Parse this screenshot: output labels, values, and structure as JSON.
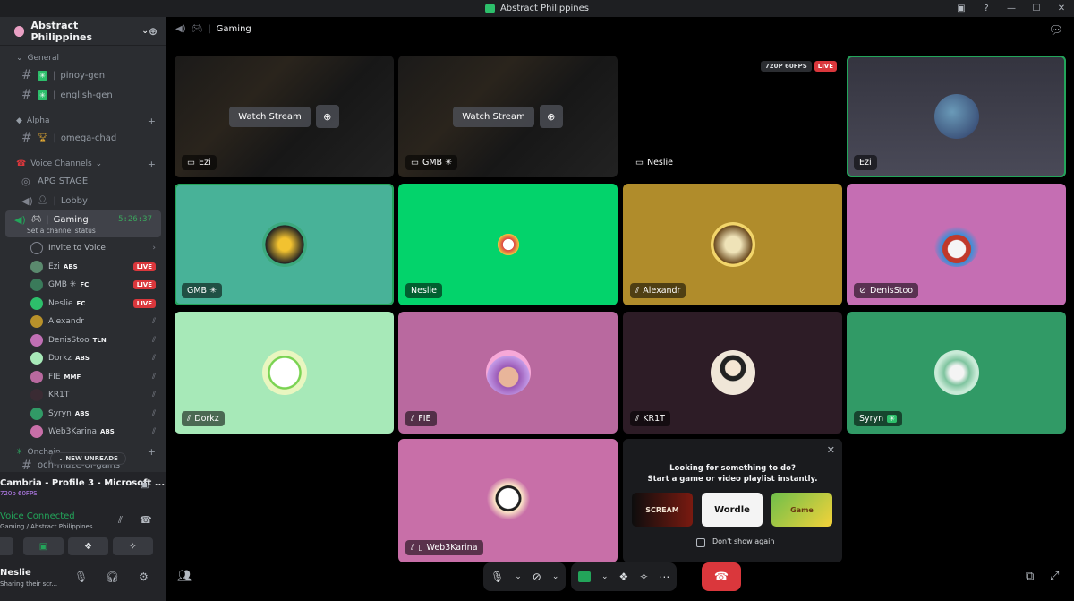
{
  "window": {
    "title": "Abstract Philippines",
    "controls": [
      "▣",
      "?",
      "—",
      "☐",
      "✕"
    ]
  },
  "server": {
    "name": "Abstract Philippines"
  },
  "categories": {
    "general": "General",
    "alpha": "Alpha",
    "voice": "Voice Channels",
    "onchain": "Onchain"
  },
  "channels": {
    "pinoy": "pinoy-gen",
    "english": "english-gen",
    "omega": "omega-chad",
    "apg": "APG STAGE",
    "lobby": "Lobby",
    "gaming": "Gaming",
    "gaming_timer": "5:26:37",
    "gaming_status": "Set a channel status",
    "invite": "Invite to Voice",
    "och": "och-maze-of-gains"
  },
  "voice_users": [
    {
      "name": "Ezi",
      "tag": "ABS",
      "live": "LIVE",
      "color": "#5b8a6e"
    },
    {
      "name": "GMB ✳",
      "tag": "FC",
      "live": "LIVE",
      "color": "#3a7a5a"
    },
    {
      "name": "Neslie",
      "tag": "FC",
      "live": "LIVE",
      "color": "#2dbf6b"
    },
    {
      "name": "Alexandr",
      "tag": "",
      "live": "",
      "color": "#b8912a"
    },
    {
      "name": "DenisStoo",
      "tag": "TLN",
      "live": "",
      "color": "#c06fb4"
    },
    {
      "name": "Dorkz",
      "tag": "ABS",
      "live": "",
      "color": "#a7e9b8"
    },
    {
      "name": "FIE",
      "tag": "MMF",
      "live": "",
      "color": "#b9699f"
    },
    {
      "name": "KR1T",
      "tag": "",
      "live": "",
      "color": "#3a2b33"
    },
    {
      "name": "Syryn",
      "tag": "ABS",
      "live": "",
      "color": "#319a66"
    },
    {
      "name": "Web3Karina",
      "tag": "ABS",
      "live": "",
      "color": "#c86fa8"
    }
  ],
  "unreads": "NEW UNREADS",
  "stream": {
    "title": "Cambria - Profile 3 - Microsoft ...",
    "quality": "720p 60FPS"
  },
  "voice": {
    "status": "Voice Connected",
    "location": "Gaming / Abstract Philippines"
  },
  "user": {
    "name": "Neslie",
    "status": "Sharing their scr..."
  },
  "header": {
    "channel": "Gaming"
  },
  "tiles": {
    "watch_label": "Watch Stream",
    "ezi_stream": "Ezi",
    "gmb_stream": "GMB ✳",
    "neslie_stream": "Neslie",
    "quality_badge": "720P 60FPS",
    "live_badge": "LIVE",
    "ezi": "Ezi",
    "gmb": "GMB ✳",
    "neslie": "Neslie",
    "alexandr": "Alexandr",
    "denis": "DenisStoo",
    "dorkz": "Dorkz",
    "fie": "FIE",
    "krit": "KR1T",
    "syryn": "Syryn",
    "karina": "Web3Karina"
  },
  "activity": {
    "line1": "Looking for something to do?",
    "line2": "Start a game or video playlist instantly.",
    "cards": [
      "SCREAM",
      "Wordle",
      "Game"
    ],
    "dont_show": "Don't show again"
  },
  "colors": {
    "gmb_tile": "#48b298",
    "neslie_tile": "#03d36b",
    "alexandr_tile": "#b08c2b",
    "denis_tile": "#c56eb3",
    "dorkz_tile": "#a7e9b8",
    "fie_tile": "#b9699f",
    "krit_tile": "#2d1c26",
    "syryn_tile": "#319a66",
    "karina_tile": "#c86fa8",
    "ezi_tile": "#3e3e4b"
  }
}
